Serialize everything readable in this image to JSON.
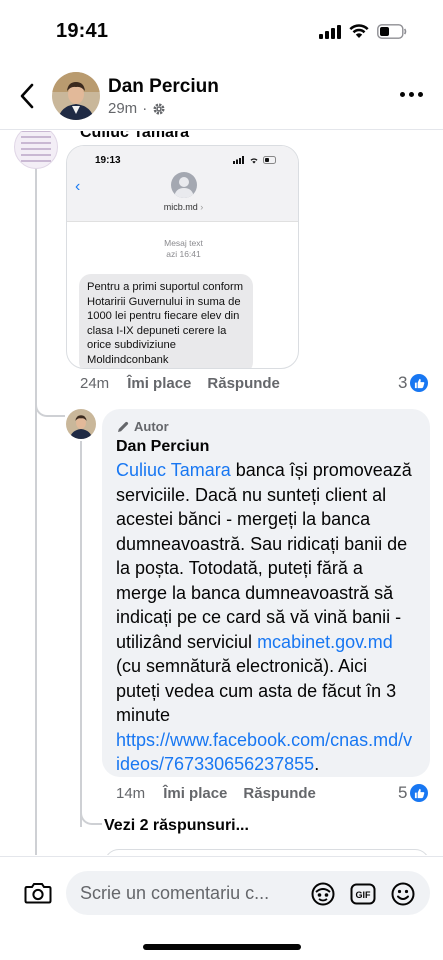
{
  "status_bar": {
    "time": "19:41"
  },
  "header": {
    "name": "Dan Perciun",
    "time": "29m",
    "separator": "·"
  },
  "previous_comment": {
    "author": "Culiuc Tamara",
    "attachment": {
      "time": "19:13",
      "sender": "micb.md",
      "sender_chevron": "›",
      "kind": "Mesaj text",
      "received": "azi 16:41",
      "message": "Pentru a primi suportul conform Hotaririi Guvernului in suma de 1000 lei pentru fiecare elev din clasa I-IX depuneti cerere la orice subdiviziune Moldindconbank"
    },
    "age": "24m",
    "like_label": "Îmi place",
    "reply_label": "Răspunde",
    "like_count": "3"
  },
  "author_reply": {
    "badge": "Autor",
    "name": "Dan Perciun",
    "mention": "Culiuc Tamara",
    "text_1": " banca își promovează serviciile. Dacă nu sunteți client al acestei bănci - mergeți la banca dumneavoastră. Sau ridicați banii de la poșta. Totodată, puteți fără a merge la banca dumneavoastră să indicați pe ce card să vă vină banii - utilizând serviciul ",
    "link_1": "mcabinet.gov.md",
    "text_2": " (cu semnătură electronică). Aici puteți vedea cum asta de făcut în 3 minute ",
    "link_2": "https://www.facebook.com/cnas.md/videos/767330656237855",
    "text_3": ".",
    "age": "14m",
    "like_label": "Îmi place",
    "reply_label": "Răspunde",
    "like_count": "5"
  },
  "view_replies": "Vezi 2 răspunsuri...",
  "composer": {
    "placeholder": "Scrie un comentariu c...",
    "gif_label": "GIF"
  },
  "colors": {
    "accent": "#1877f2",
    "bubble": "#f0f2f5",
    "muted": "#65676b"
  }
}
